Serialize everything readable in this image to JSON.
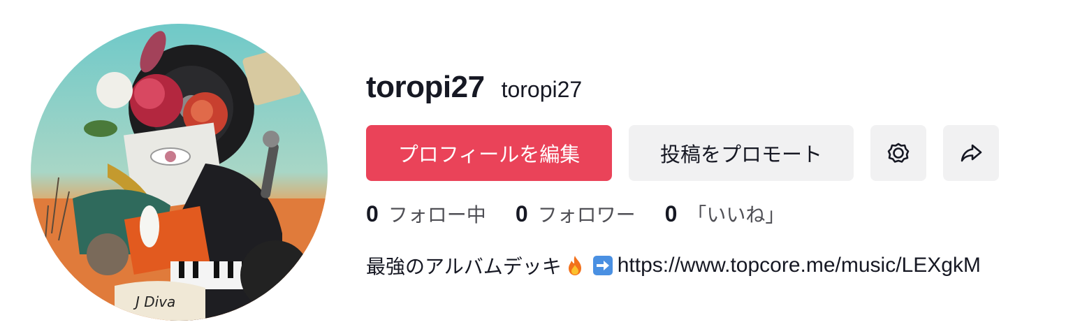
{
  "profile": {
    "username": "toropi27",
    "nickname": "toropi27",
    "avatar_label": "J Diva"
  },
  "actions": {
    "edit_profile": "プロフィールを編集",
    "promote_post": "投稿をプロモート",
    "settings_icon": "gear-icon",
    "share_icon": "share-arrow-icon"
  },
  "stats": {
    "following_count": "0",
    "following_label": "フォロー中",
    "followers_count": "0",
    "followers_label": "フォロワー",
    "likes_count": "0",
    "likes_label": "「いいね」"
  },
  "bio": {
    "text": "最強のアルバムデッキ",
    "emoji_1": "fire-icon",
    "emoji_2": "right-arrow-icon",
    "link": "https://www.topcore.me/music/LEXgkM"
  },
  "colors": {
    "primary": "#ea4359",
    "secondary_bg": "#f1f1f2",
    "text": "#161823",
    "muted_text": "#4f4f55"
  }
}
